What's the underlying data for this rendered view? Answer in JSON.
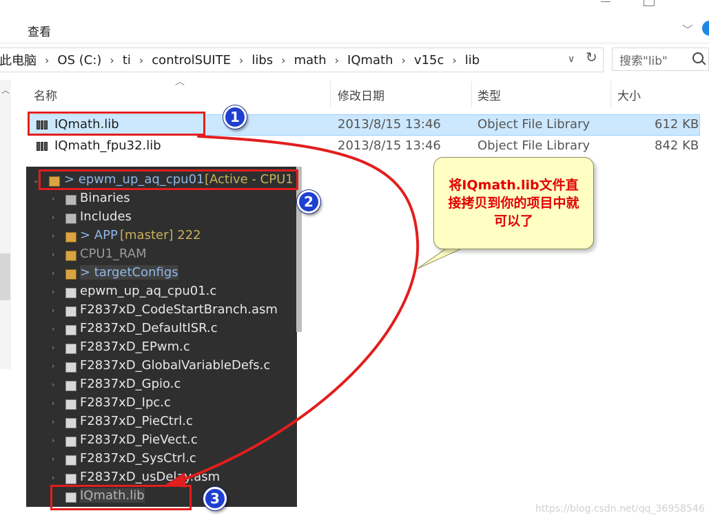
{
  "ribbon": {
    "tab": "查看"
  },
  "address": {
    "crumbs": [
      "此电脑",
      "OS (C:)",
      "ti",
      "controlSUITE",
      "libs",
      "math",
      "IQmath",
      "v15c",
      "lib"
    ],
    "separator": "›"
  },
  "search": {
    "placeholder": "搜索\"lib\""
  },
  "columns": {
    "name": "名称",
    "modified": "修改日期",
    "type": "类型",
    "size": "大小"
  },
  "files": [
    {
      "name": "IQmath.lib",
      "modified": "2013/8/15 13:46",
      "type": "Object File Library",
      "size": "612 KB",
      "selected": true
    },
    {
      "name": "IQmath_fpu32.lib",
      "modified": "2013/8/15 13:46",
      "type": "Object File Library",
      "size": "842 KB",
      "selected": false
    }
  ],
  "project": {
    "name": "> epwm_up_aq_cpu01",
    "status": "[Active - CPU1",
    "items": [
      {
        "label": "Binaries",
        "icon": "binaries-icon",
        "twisty": "›"
      },
      {
        "label": "Includes",
        "icon": "includes-icon",
        "twisty": "›"
      },
      {
        "label": "> APP",
        "extra": "[master] 222",
        "icon": "folder-icon",
        "twisty": "›"
      },
      {
        "label": "CPU1_RAM",
        "icon": "folder-icon",
        "twisty": "›"
      },
      {
        "label": "> targetConfigs",
        "icon": "folder-icon",
        "twisty": "›"
      },
      {
        "label": "epwm_up_aq_cpu01.c",
        "icon": "c-file-icon",
        "twisty": "›"
      },
      {
        "label": "F2837xD_CodeStartBranch.asm",
        "icon": "asm-file-icon",
        "twisty": "›"
      },
      {
        "label": "F2837xD_DefaultISR.c",
        "icon": "c-file-icon",
        "twisty": "›"
      },
      {
        "label": "F2837xD_EPwm.c",
        "icon": "c-file-icon",
        "twisty": "›"
      },
      {
        "label": "F2837xD_GlobalVariableDefs.c",
        "icon": "c-file-icon",
        "twisty": "›"
      },
      {
        "label": "F2837xD_Gpio.c",
        "icon": "c-file-icon",
        "twisty": "›"
      },
      {
        "label": "F2837xD_Ipc.c",
        "icon": "c-file-icon",
        "twisty": "›"
      },
      {
        "label": "F2837xD_PieCtrl.c",
        "icon": "c-file-icon",
        "twisty": "›"
      },
      {
        "label": "F2837xD_PieVect.c",
        "icon": "c-file-icon",
        "twisty": "›"
      },
      {
        "label": "F2837xD_SysCtrl.c",
        "icon": "c-file-icon",
        "twisty": "›"
      },
      {
        "label": "F2837xD_usDelay.asm",
        "icon": "asm-file-icon",
        "twisty": "›"
      },
      {
        "label": "IQmath.lib",
        "icon": "lib-file-icon",
        "twisty": ""
      }
    ]
  },
  "annotations": {
    "badge1": "1",
    "badge2": "2",
    "badge3": "3",
    "callout": "将IQmath.lib文件直接拷贝到你的项目中就可以了"
  },
  "watermark": "https://blog.csdn.net/qq_36958546",
  "colors": {
    "highlight_red": "#e21e1e",
    "badge_blue": "#1f3fd1",
    "selection_blue": "#cce8ff",
    "callout_bg": "#ffffc4"
  }
}
